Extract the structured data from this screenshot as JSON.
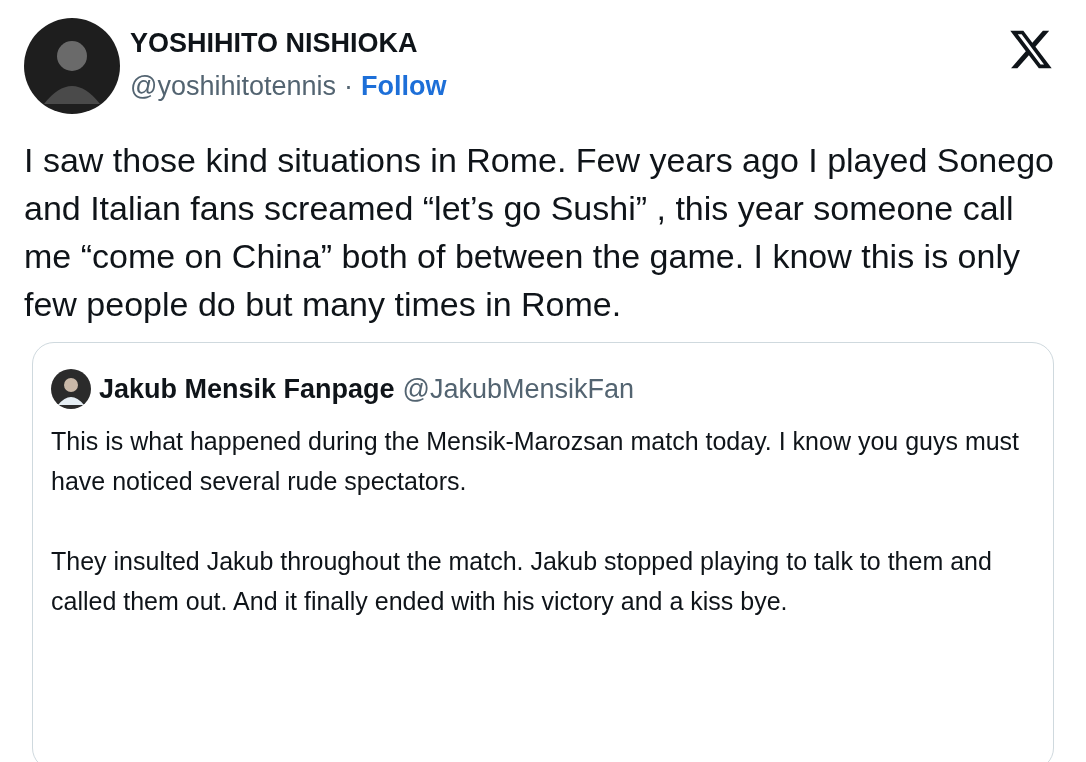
{
  "author": {
    "name": "YOSHIHITO NISHIOKA",
    "handle": "@yoshihitotennis",
    "separator": "·",
    "follow": "Follow"
  },
  "text": "I saw those kind situations in Rome. Few years ago I played Sonego and Italian fans screamed “let’s go Sushi” , this year someone call me “come on China” both of between the game. I know this is only few people do but many times in Rome.",
  "quote": {
    "name": "Jakub Mensik Fanpage",
    "handle": "@JakubMensikFan",
    "paragraphs": [
      "This is what happened during the Mensik-Marozsan match today. I know you guys must have noticed several rude spectators.",
      "They insulted Jakub throughout the match. Jakub stopped playing to talk to them and called them out. And it finally ended with his victory and a kiss bye."
    ]
  }
}
